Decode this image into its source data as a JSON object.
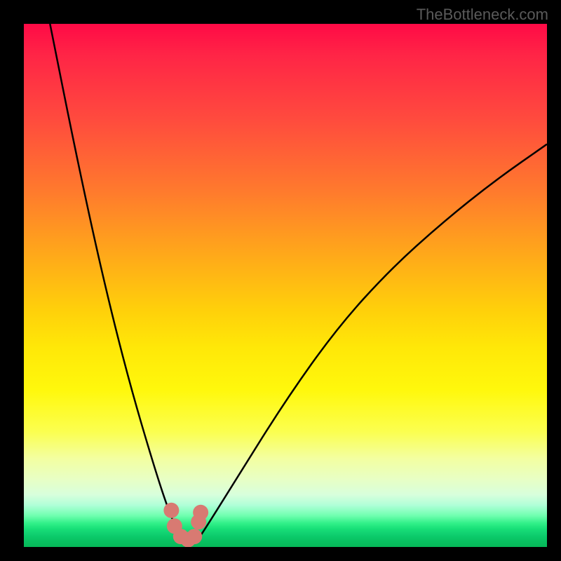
{
  "watermark": "TheBottleneck.com",
  "chart_data": {
    "type": "line",
    "title": "",
    "xlabel": "",
    "ylabel": "",
    "xlim": [
      0,
      100
    ],
    "ylim": [
      0,
      100
    ],
    "series": [
      {
        "name": "curve",
        "x": [
          5,
          10,
          15,
          20,
          25,
          28,
          30,
          31.5,
          33,
          35,
          40,
          50,
          60,
          70,
          80,
          90,
          100
        ],
        "y": [
          100,
          75,
          52,
          32,
          15,
          6,
          2,
          0.5,
          1,
          4,
          12,
          28,
          42,
          53,
          62,
          70,
          77
        ]
      }
    ],
    "markers": [
      {
        "x": 28.2,
        "y": 7.0
      },
      {
        "x": 28.8,
        "y": 4.0
      },
      {
        "x": 30.0,
        "y": 2.0
      },
      {
        "x": 31.4,
        "y": 1.4
      },
      {
        "x": 32.6,
        "y": 2.0
      },
      {
        "x": 33.4,
        "y": 4.8
      },
      {
        "x": 33.8,
        "y": 6.6
      }
    ],
    "marker_style": {
      "color": "#d87a72",
      "radius": 11
    },
    "line_style": {
      "color": "#000000",
      "width": 2.5
    }
  }
}
